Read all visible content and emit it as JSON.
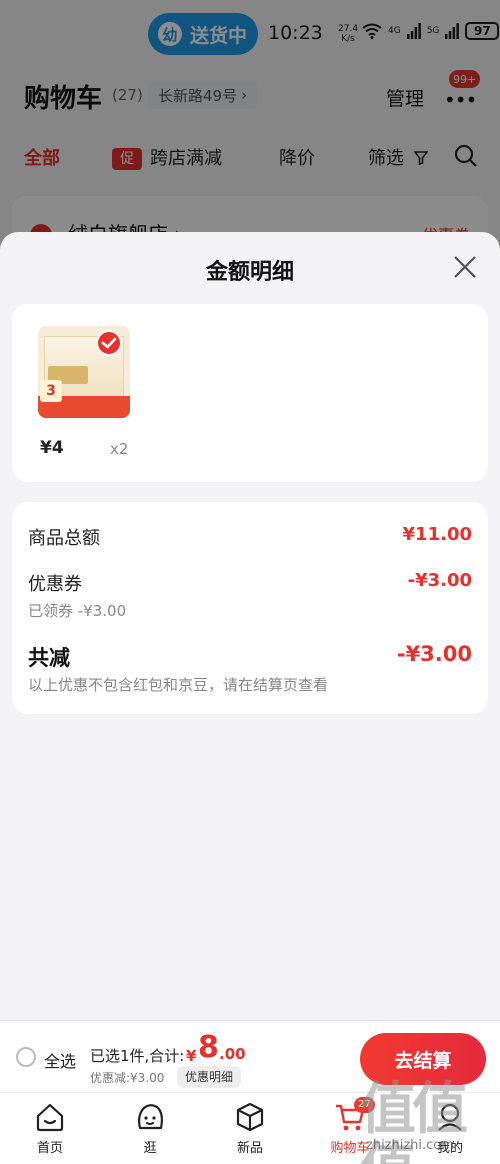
{
  "status_bar": {
    "delivery_pill": "送货中",
    "delivery_icon": "幼",
    "time": "10:23",
    "net_speed_top": "27.4",
    "net_speed_bottom": "K/s",
    "signal_1": "4G",
    "signal_2": "5G",
    "battery": "97"
  },
  "cart_header": {
    "title": "购物车",
    "count": "(27)",
    "address": "长新路49号",
    "address_chevron": "›",
    "manage_label": "管理",
    "more_label": "•••",
    "more_badge": "99+"
  },
  "filter_bar": {
    "tab_all": "全部",
    "promo_tag": "促",
    "tab_cross_store": "跨店满减",
    "tab_price_drop": "降价",
    "tab_filter": "筛选"
  },
  "store": {
    "name": "绒白旗舰店 ›",
    "coupon": "优惠券"
  },
  "sheet": {
    "title": "金额明细",
    "items": [
      {
        "thumb_label": "3",
        "price": "¥4",
        "quantity": "x2"
      }
    ],
    "amounts": {
      "goods_total_label": "商品总额",
      "goods_total_value": "¥11.00",
      "coupon_label": "优惠券",
      "coupon_value": "-¥3.00",
      "coupon_sub": "已领券 -¥3.00",
      "total_reduce_label": "共减",
      "total_reduce_value": "-¥3.00",
      "note": "以上优惠不包含红包和京豆，请在结算页查看"
    }
  },
  "checkout": {
    "select_all": "全选",
    "selected_summary": "已选1件,合计:",
    "currency": "¥",
    "total_integer": "8",
    "total_decimal": ".00",
    "discount_line": "优惠减:¥3.00",
    "detail_chip": "优惠明细",
    "checkout_button": "去结算"
  },
  "bottom_nav": {
    "items": [
      {
        "label": "首页"
      },
      {
        "label": "逛"
      },
      {
        "label": "新品"
      },
      {
        "label": "购物车",
        "badge": "27"
      },
      {
        "label": "我的"
      }
    ]
  },
  "watermark": {
    "text": "值值值",
    "url": "zhizhizhi.com"
  }
}
